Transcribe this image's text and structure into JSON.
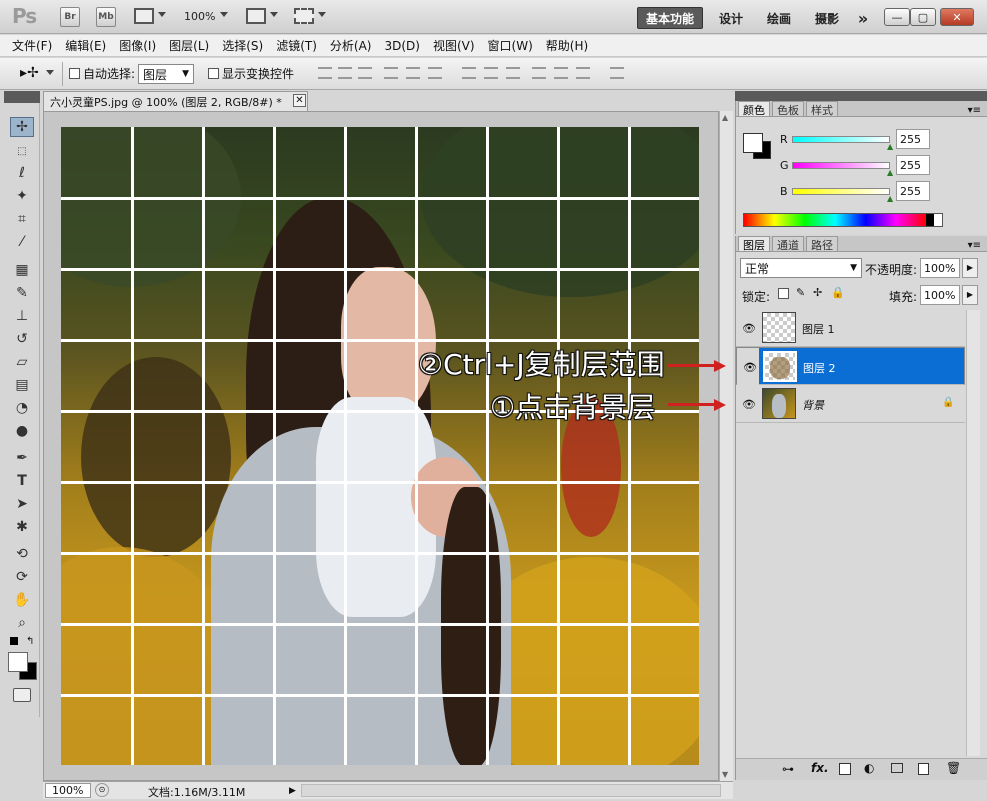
{
  "titlebar": {
    "logo": "Ps",
    "br": "Br",
    "mb": "Mb",
    "zoom": "100%",
    "workspaces": [
      "基本功能",
      "设计",
      "绘画",
      "摄影"
    ],
    "more": "»",
    "win_min": "—",
    "win_max": "▢",
    "win_close": "✕"
  },
  "menu": [
    "文件(F)",
    "编辑(E)",
    "图像(I)",
    "图层(L)",
    "选择(S)",
    "滤镜(T)",
    "分析(A)",
    "3D(D)",
    "视图(V)",
    "窗口(W)",
    "帮助(H)"
  ],
  "options": {
    "auto_select_label": "自动选择:",
    "auto_select_value": "图层",
    "show_transform_label": "显示变换控件"
  },
  "document": {
    "tab_title": "六小灵童PS.jpg @ 100% (图层 2, RGB/8#) *",
    "zoom": "100%",
    "doc_info": "文档:1.16M/3.11M"
  },
  "color_panel": {
    "tabs": [
      "颜色",
      "色板",
      "样式"
    ],
    "r_label": "R",
    "g_label": "G",
    "b_label": "B",
    "r_value": "255",
    "g_value": "255",
    "b_value": "255"
  },
  "layers_panel": {
    "tabs": [
      "图层",
      "通道",
      "路径"
    ],
    "blend_mode": "正常",
    "opacity_label": "不透明度:",
    "opacity_value": "100%",
    "lock_label": "锁定:",
    "fill_label": "填充:",
    "fill_value": "100%",
    "layers": [
      {
        "name": "图层 1"
      },
      {
        "name": "图层 2"
      },
      {
        "name": "背景"
      }
    ],
    "footer_fx": "fx."
  },
  "annotations": {
    "step2": "②Ctrl+J复制层范围",
    "step1": "①点击背景层"
  },
  "colors": {
    "selected_layer": "#0a6ed4",
    "annotation_arrow": "#d02020",
    "chrome_dark": "#5a5a5a"
  }
}
